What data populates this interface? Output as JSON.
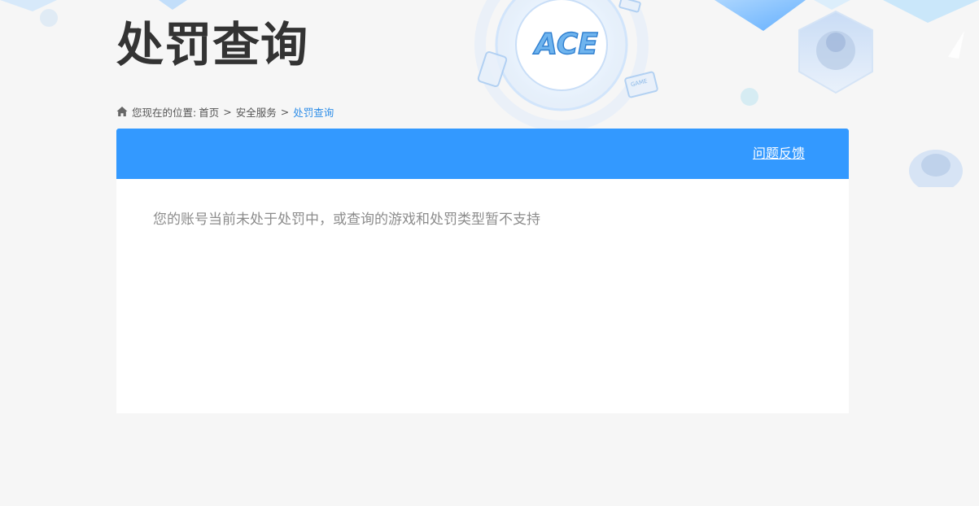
{
  "header": {
    "title": "处罚查询",
    "logo_text": "ACE",
    "device_badge_text": "GAME"
  },
  "breadcrumb": {
    "prefix": "您现在的位置:",
    "items": [
      {
        "label": "首页"
      },
      {
        "label": "安全服务"
      },
      {
        "label": "处罚查询"
      }
    ],
    "separator": ">"
  },
  "panel": {
    "feedback_label": "问题反馈",
    "message": "您的账号当前未处于处罚中，或查询的游戏和处罚类型暂不支持"
  },
  "colors": {
    "accent": "#3399ff",
    "link_current": "#2f8ee8",
    "title": "#333333",
    "message": "#8c8c8c",
    "background": "#f6f6f6"
  }
}
